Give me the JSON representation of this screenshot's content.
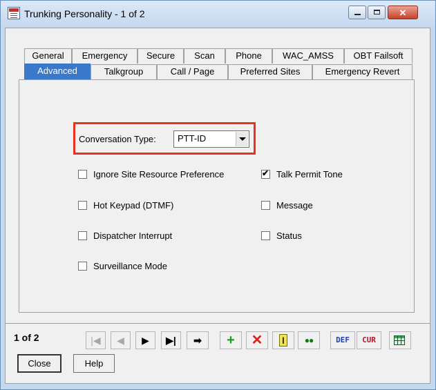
{
  "window": {
    "title": "Trunking Personality - 1 of 2",
    "controls": {
      "minimize": "min-icon",
      "maximize": "max-icon",
      "close": "✕"
    }
  },
  "tabs": {
    "row1": [
      "General",
      "Emergency",
      "Secure",
      "Scan",
      "Phone",
      "WAC_AMSS",
      "OBT Failsoft"
    ],
    "row2": [
      "Advanced",
      "Talkgroup",
      "Call / Page",
      "Preferred Sites",
      "Emergency Revert"
    ],
    "active": "Advanced"
  },
  "advanced": {
    "conversation_type": {
      "label": "Conversation Type:",
      "value": "PTT-ID"
    },
    "checkboxes": {
      "ignore_site_resource_preference": {
        "label": "Ignore Site Resource Preference",
        "checked": false
      },
      "hot_keypad": {
        "label": "Hot Keypad (DTMF)",
        "checked": false
      },
      "dispatcher_interrupt": {
        "label": "Dispatcher Interrupt",
        "checked": false
      },
      "surveillance_mode": {
        "label": "Surveillance Mode",
        "checked": false
      },
      "talk_permit_tone": {
        "label": "Talk Permit Tone",
        "checked": true,
        "mark": "✔"
      },
      "message": {
        "label": "Message",
        "checked": false
      },
      "status": {
        "label": "Status",
        "checked": false
      }
    },
    "highlight_color": "#e8321e"
  },
  "record_nav": {
    "label": "1 of 2",
    "buttons": {
      "first": "|◀",
      "prev": "◀",
      "next": "▶",
      "last": "▶|",
      "goto": "➡",
      "add": "+",
      "delete": "✕",
      "rename": "I",
      "view": "●●",
      "def": "DEF",
      "cur": "CUR",
      "grid": "grid-icon"
    }
  },
  "footer": {
    "close": "Close",
    "help": "Help"
  },
  "colors": {
    "tab_active_bg": "#3a78c9",
    "add_icon": "#1c9e1c",
    "delete_icon": "#e0201a"
  }
}
